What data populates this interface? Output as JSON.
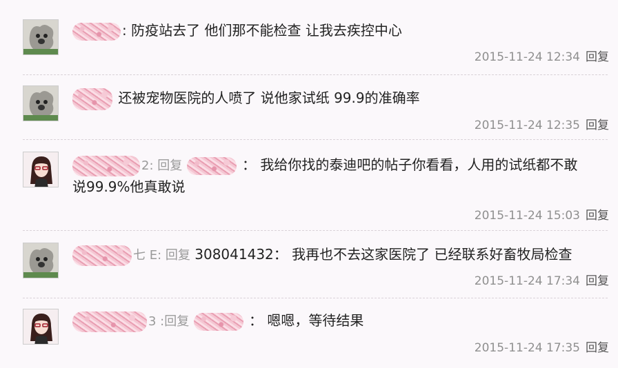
{
  "comments": [
    {
      "avatar": "dog-icon",
      "pre_text": ":",
      "reply_to": "",
      "text": "防疫站去了 他们那不能检查 让我去疾控中心",
      "timestamp": "2015-11-24 12:34",
      "reply_label": "回复"
    },
    {
      "avatar": "dog-icon",
      "pre_text": "",
      "reply_to": "",
      "text": "还被宠物医院的人喷了 说他家试纸 99.9的准确率",
      "timestamp": "2015-11-24 12:35",
      "reply_label": "回复"
    },
    {
      "avatar": "girl-icon",
      "pre_text": "2: 回复",
      "reply_to": "",
      "text": "： 我给你找的泰迪吧的帖子你看看，人用的试纸都不敢",
      "text_line2": "说99.9%他真敢说",
      "timestamp": "2015-11-24 15:03",
      "reply_label": "回复"
    },
    {
      "avatar": "dog-icon",
      "pre_text": "七  E: 回复",
      "reply_to": "308041432",
      "text": "： 我再也不去这家医院了 已经联系好畜牧局检查",
      "timestamp": "2015-11-24 17:34",
      "reply_label": "回复"
    },
    {
      "avatar": "girl-icon",
      "pre_text": "3  :回复",
      "reply_to": "",
      "text": "： 嗯嗯，等待结果",
      "timestamp": "2015-11-24 17:35",
      "reply_label": "回复"
    }
  ]
}
